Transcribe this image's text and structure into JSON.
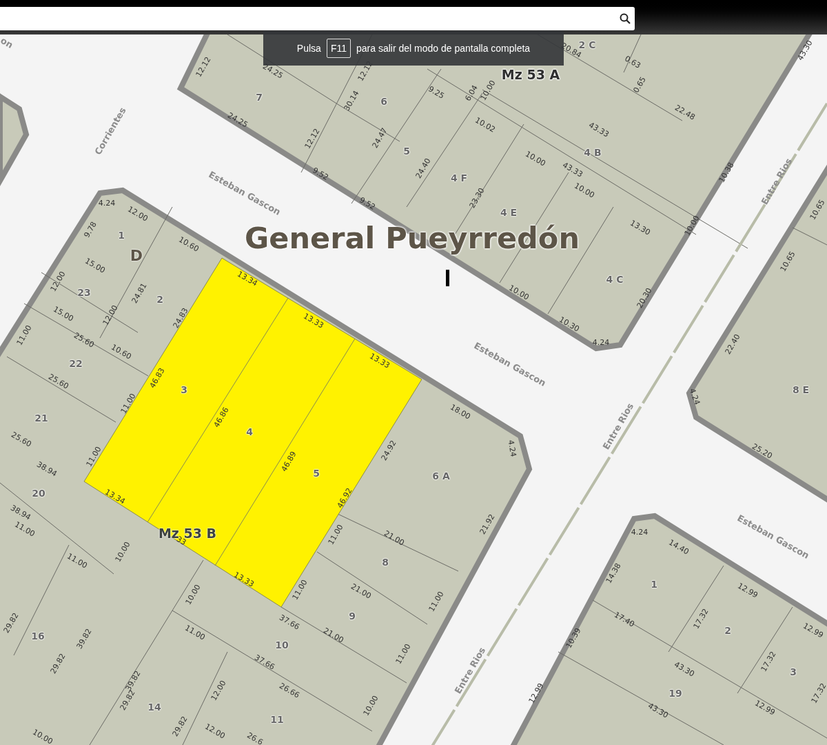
{
  "fullscreen_notice": {
    "before": "Pulsa",
    "key": "F11",
    "after": "para salir del modo de pantalla completa"
  },
  "map": {
    "title": "General Pueyrredón",
    "streets": [
      "on",
      "Corrientes",
      "Esteban Gascon",
      "Esteban Gascon",
      "Esteban Gascon",
      "Entre Rios",
      "Entre Rios",
      "Entre Rios"
    ],
    "blocks": [
      "Mz 53 A",
      "Mz 53 B",
      "D"
    ],
    "parcels": [
      "7",
      "6",
      "5",
      "4 F",
      "4 E",
      "4 B",
      "4 C",
      "2 C",
      "1",
      "23",
      "2",
      "22",
      "3",
      "21",
      "4",
      "5",
      "6 A",
      "20",
      "8",
      "9",
      "10",
      "16",
      "14",
      "11",
      "8 E",
      "1",
      "2",
      "3",
      "19"
    ],
    "measurements": [
      "12.12",
      "24.25",
      "12.12",
      "20.84",
      "0.63",
      "0.65",
      "43.30",
      "30.14",
      "24.25",
      "12.12",
      "9.25",
      "6.04",
      "10.00",
      "22.48",
      "43.33",
      "10.02",
      "24.47",
      "9.52",
      "9.52",
      "24.40",
      "10.00",
      "43.33",
      "10.00",
      "23.30",
      "10.38",
      "13.30",
      "10.00",
      "10.00",
      "20.30",
      "10.30",
      "4.24",
      "4.24",
      "12.00",
      "9.78",
      "10.60",
      "15.00",
      "12.00",
      "24.81",
      "13.34",
      "15.00",
      "12.00",
      "24.83",
      "13.33",
      "11.00",
      "25.60",
      "10.60",
      "13.33",
      "46.83",
      "25.60",
      "11.00",
      "46.86",
      "18.00",
      "25.60",
      "24.92",
      "4.24",
      "11.00",
      "46.89",
      "38.94",
      "13.34",
      "46.92",
      "38.94",
      "11.00",
      "11.00",
      "21.00",
      "33",
      "11.00",
      "10.00",
      "21.92",
      "13.33",
      "10.00",
      "11.00",
      "21.00",
      "11.00",
      "37.66",
      "21.00",
      "29.82",
      "39.82",
      "11.00",
      "11.00",
      "29.82",
      "37.66",
      "39.82",
      "12.00",
      "26.66",
      "29.82",
      "10.00",
      "29.82",
      "12.00",
      "26.6",
      "10.00",
      "10.65",
      "10.65",
      "22.40",
      "4.24",
      "25.20",
      "4.24",
      "14.40",
      "14.38",
      "12.99",
      "17.40",
      "17.32",
      "12.99",
      "10.39",
      "43.30",
      "17.32",
      "17.32",
      "12.99",
      "12.99",
      "43.30"
    ]
  }
}
